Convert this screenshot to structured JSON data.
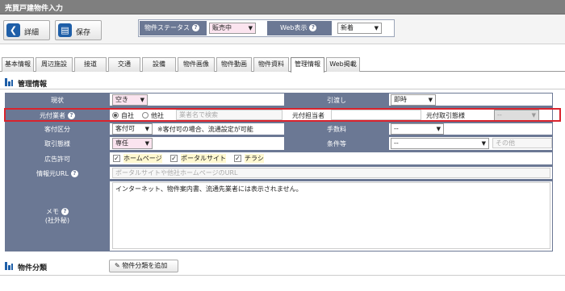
{
  "window": {
    "title": "売買戸建物件入力"
  },
  "toolbar": {
    "detail_label": "詳細",
    "save_label": "保存",
    "status_label": "物件ステータス",
    "status_value": "販売中",
    "web_label": "Web表示",
    "web_value": "新着"
  },
  "tabs": [
    {
      "label": "基本情報"
    },
    {
      "label": "周辺施設"
    },
    {
      "label": "接道"
    },
    {
      "label": "交通"
    },
    {
      "label": "設備"
    },
    {
      "label": "物件画像"
    },
    {
      "label": "物件動画"
    },
    {
      "label": "物件資料"
    },
    {
      "label": "管理情報",
      "active": true
    },
    {
      "label": "Web掲載"
    }
  ],
  "section_management": {
    "title": "管理情報"
  },
  "form": {
    "status": {
      "label": "現状",
      "value": "空き"
    },
    "handover": {
      "label": "引渡し",
      "value": "即時"
    },
    "original_agent": {
      "label": "元付業者",
      "radio_own": "自社",
      "radio_other": "他社",
      "search_placeholder": "業者名で検索",
      "contact_label": "元付担当者",
      "manner_label": "元付取引態様",
      "manner_value": "--"
    },
    "brokerage": {
      "label": "客付区分",
      "value": "客付可",
      "note": "※客付可の場合、流通設定が可能"
    },
    "commission": {
      "label": "手数料",
      "value": "--"
    },
    "transaction": {
      "label": "取引態様",
      "value": "専任"
    },
    "conditions": {
      "label": "条件等",
      "value": "--",
      "other_placeholder": "その他"
    },
    "ad_permission": {
      "label": "広告許可",
      "options": [
        "ホームページ",
        "ポータルサイト",
        "チラシ"
      ]
    },
    "info_url": {
      "label": "情報元URL",
      "placeholder": "ポータルサイトや他社ホームページのURL"
    },
    "memo": {
      "label": "メモ",
      "sublabel": "(社外秘)",
      "value": "インターネット、物件案内書、流通先業者には表示されません。"
    }
  },
  "section_category": {
    "title": "物件分類",
    "add_button": "物件分類を追加"
  },
  "colors": {
    "label_bg": "#6b7894",
    "highlight": "#d9232d",
    "required_bg": "#fbe4ef",
    "icon_blue": "#1f5fa8"
  }
}
